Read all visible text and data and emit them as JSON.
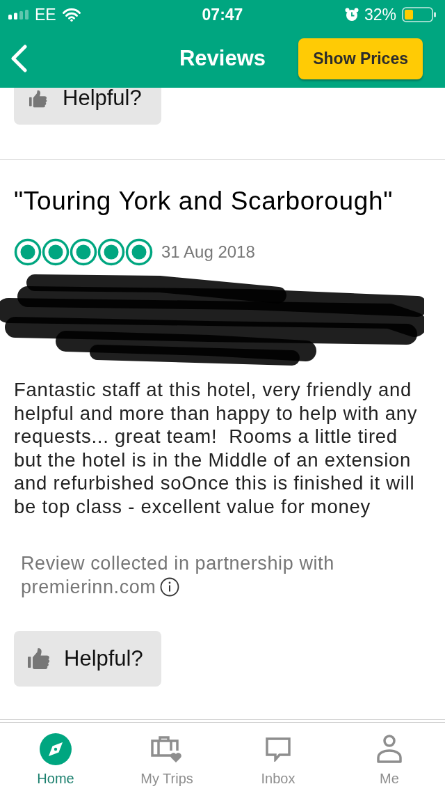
{
  "status_bar": {
    "carrier": "EE",
    "time": "07:47",
    "battery": "32%"
  },
  "header": {
    "title": "Reviews",
    "action": "Show Prices"
  },
  "reviews": [
    {
      "kind": "partial",
      "helpful": "Helpful?"
    },
    {
      "kind": "full",
      "title": "\"Touring York and Scarborough\"",
      "stars": 5,
      "date": "31 Aug 2018",
      "text": "Fantastic staff at this hotel, very friendly and helpful and more than happy to help with any requests... great team!  Rooms a little tired but the hotel is in the Middle of an extension and refurbished soOnce this is finished it will be top class - excellent value for money",
      "source_note": "Review collected in partnership with",
      "source_partner": "premierinn.com",
      "helpful": "Helpful?"
    }
  ],
  "tabs": [
    {
      "label": "Home",
      "selected": true
    },
    {
      "label": "My Trips",
      "selected": false
    },
    {
      "label": "Inbox",
      "selected": false
    },
    {
      "label": "Me",
      "selected": false
    }
  ]
}
